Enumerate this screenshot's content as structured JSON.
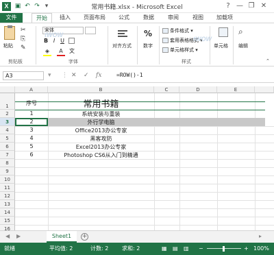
{
  "titlebar": {
    "title": "常用书籍.xlsx - Microsoft Excel",
    "app_icon": "X",
    "help": "?",
    "minimize": "—",
    "restore": "❐",
    "close": "✕"
  },
  "tabs": [
    "文件",
    "开始",
    "插入",
    "页面布局",
    "公式",
    "数据",
    "审阅",
    "视图",
    "加载项"
  ],
  "ribbon": {
    "clipboard_label": "剪贴板",
    "paste_label": "粘贴",
    "font_name": "宋体",
    "font_label": "字体",
    "align_label": "对齐方式",
    "number_label": "数字",
    "percent": "%",
    "conditional": "条件格式 ▾",
    "table_format": "套用表格格式 ▾",
    "cell_styles": "单元格样式 ▾",
    "styles_label": "样式",
    "cells_label": "单元格",
    "edit_label": "编辑",
    "bold": "B",
    "italic": "I",
    "underline": "U",
    "font_color": "A",
    "wen": "文",
    "watermark": "tWOW"
  },
  "formulabar": {
    "namebox": "A3",
    "cancel": "✕",
    "enter": "✓",
    "fx": "fx",
    "formula": "=ROW()-1"
  },
  "grid": {
    "columns": [
      "A",
      "B",
      "C",
      "D",
      "E"
    ],
    "rows": [
      "1",
      "2",
      "3",
      "4",
      "5",
      "6",
      "7",
      "8",
      "9",
      "10",
      "11",
      "12",
      "13",
      "14",
      "15",
      "16"
    ],
    "data": [
      {
        "a": "序号",
        "b": "常用书籍"
      },
      {
        "a": "1",
        "b": "系统安装与重装"
      },
      {
        "a": "2",
        "b": "外行学电脑"
      },
      {
        "a": "3",
        "b": "Office2013办公专家"
      },
      {
        "a": "4",
        "b": "黑客攻防"
      },
      {
        "a": "5",
        "b": "Excel2013办公专家"
      },
      {
        "a": "6",
        "b": "Photoshop CS6从入门到精通"
      }
    ]
  },
  "sheets": {
    "tab": "Sheet1",
    "prev": "◀",
    "next": "▶",
    "add": "+"
  },
  "status": {
    "ready": "就绪",
    "average": "平均值: 2",
    "count": "计数: 2",
    "sum": "求和: 2",
    "zoom": "100%",
    "minus": "−",
    "plus": "+"
  }
}
